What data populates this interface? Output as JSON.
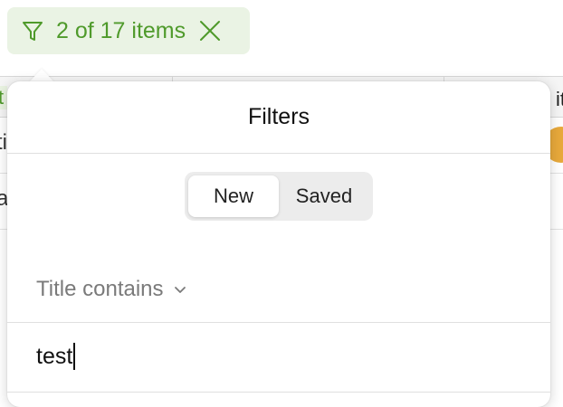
{
  "filter_chip": {
    "label": "2 of 17 items",
    "icon": "filter-icon",
    "close_icon": "close-icon",
    "color": "#4f9a2b",
    "background": "#eaf3e4"
  },
  "table": {
    "header_fragment_left": "t",
    "header_fragment_right": "it",
    "rows": [
      {
        "fragment_left": "ti",
        "status_color": "#e8a93b"
      },
      {
        "fragment_left": "a"
      }
    ]
  },
  "popover": {
    "title": "Filters",
    "segments": [
      {
        "label": "New",
        "active": true
      },
      {
        "label": "Saved",
        "active": false
      }
    ],
    "criterion": {
      "label": "Title contains",
      "icon": "chevron-down-icon"
    },
    "input": {
      "value": "test"
    }
  }
}
